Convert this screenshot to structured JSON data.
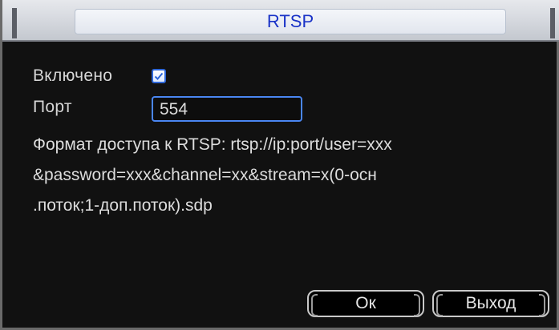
{
  "dialog": {
    "title": "RTSP"
  },
  "settings": {
    "enabled_label": "Включено",
    "enabled_checked": true,
    "port_label": "Порт",
    "port_value": "554"
  },
  "description": {
    "lines": [
      "Формат доступа к RTSP: rtsp://ip:port/user=xxx",
      "&password=xxx&channel=xx&stream=x(0-осн",
      ".поток;1-доп.поток).sdp"
    ]
  },
  "buttons": {
    "ok_label": "Ок",
    "exit_label": "Выход"
  },
  "colors": {
    "title_text": "#1a33c7",
    "accent_border": "#4a86f2",
    "background": "#111111"
  }
}
